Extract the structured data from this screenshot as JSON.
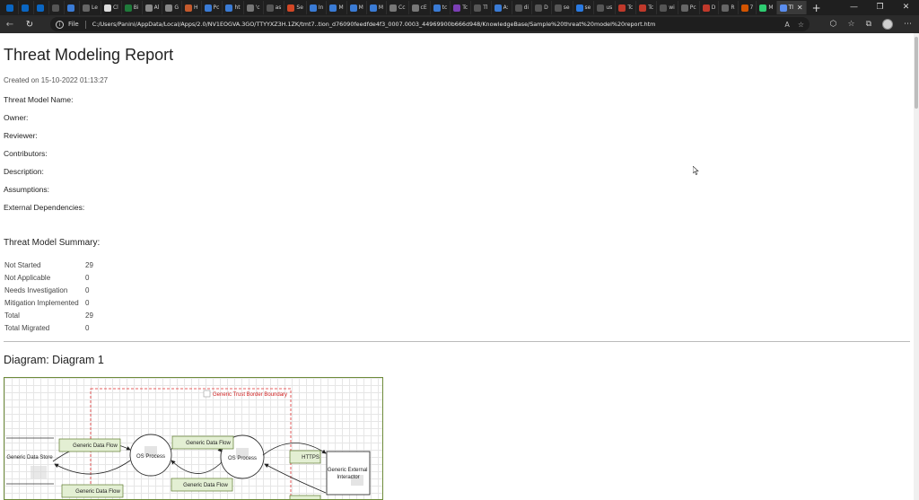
{
  "browser": {
    "tabs": [
      {
        "label": "",
        "color": "#0a66c2"
      },
      {
        "label": "",
        "color": "#0a66c2"
      },
      {
        "label": "",
        "color": "#0a66c2"
      },
      {
        "label": "",
        "color": "#555555"
      },
      {
        "label": "",
        "color": "#3a7bd5"
      },
      {
        "label": "Le",
        "color": "#666666"
      },
      {
        "label": "Cl",
        "color": "#dddddd"
      },
      {
        "label": "Bi",
        "color": "#1f7a3a"
      },
      {
        "label": "Al",
        "color": "#888888"
      },
      {
        "label": "G",
        "color": "#888888"
      },
      {
        "label": "H",
        "color": "#c45a2d"
      },
      {
        "label": "Pc",
        "color": "#3a7bd5"
      },
      {
        "label": "ht",
        "color": "#3a7bd5"
      },
      {
        "label": "'c",
        "color": "#777777"
      },
      {
        "label": "as",
        "color": "#555555"
      },
      {
        "label": "Se",
        "color": "#d24726"
      },
      {
        "label": "In",
        "color": "#3a7bd5"
      },
      {
        "label": "M",
        "color": "#3a7bd5"
      },
      {
        "label": "M",
        "color": "#3a7bd5"
      },
      {
        "label": "M",
        "color": "#3a7bd5"
      },
      {
        "label": "Cc",
        "color": "#777777"
      },
      {
        "label": "cE",
        "color": "#777777"
      },
      {
        "label": "tc",
        "color": "#3a7bd5"
      },
      {
        "label": "Tc",
        "color": "#7b3fb5"
      },
      {
        "label": "Tl",
        "color": "#555555"
      },
      {
        "label": "A:",
        "color": "#3a7bd5"
      },
      {
        "label": "di",
        "color": "#555555"
      },
      {
        "label": "D",
        "color": "#555555"
      },
      {
        "label": "se",
        "color": "#555555"
      },
      {
        "label": "se",
        "color": "#2a7ae2"
      },
      {
        "label": "us",
        "color": "#555555"
      },
      {
        "label": "Tc",
        "color": "#c0392b"
      },
      {
        "label": "Tc",
        "color": "#c0392b"
      },
      {
        "label": "wi",
        "color": "#555555"
      },
      {
        "label": "Pc",
        "color": "#666666"
      },
      {
        "label": "D",
        "color": "#c0392b"
      },
      {
        "label": "R",
        "color": "#666666"
      },
      {
        "label": "7",
        "color": "#d35400"
      },
      {
        "label": "M",
        "color": "#2ecc71"
      }
    ],
    "active_tab": {
      "label": "Tl",
      "close": "✕"
    },
    "new_tab": "+",
    "window_controls": [
      "—",
      "❐",
      "✕"
    ],
    "file_label": "File",
    "url": "C:/Users/Panini/AppData/Local/Apps/2.0/NV1EOGVA.3GO/TTYYXZ3H.1ZK/tmt7..tion_d76090feedfde4f3_0007.0003_44969900b666d948/KnowledgeBase/Sample%20threat%20model%20report.htm"
  },
  "report": {
    "title": "Threat Modeling Report",
    "created": "Created on 15-10-2022 01:13:27",
    "fields": [
      "Threat Model Name:",
      "Owner:",
      "Reviewer:",
      "Contributors:",
      "Description:",
      "Assumptions:",
      "External Dependencies:"
    ],
    "summary_title": "Threat Model Summary:",
    "summary": [
      {
        "label": "Not Started",
        "value": "29"
      },
      {
        "label": "Not Applicable",
        "value": "0"
      },
      {
        "label": "Needs Investigation",
        "value": "0"
      },
      {
        "label": "Mitigation Implemented",
        "value": "0"
      },
      {
        "label": "Total",
        "value": "29"
      },
      {
        "label": "Total Migrated",
        "value": "0"
      }
    ],
    "diagram_title": "Diagram: Diagram 1"
  },
  "diagram": {
    "boundary": "Generic Trust Border Boundary",
    "store": "Generic Data Store",
    "process1": "OS Process",
    "process2": "OS Process",
    "external": "Generic External Interactor",
    "flow1": "Generic Data Flow",
    "flow2": "Generic Data Flow",
    "flow3": "Generic Data Flow",
    "flow4": "Generic Data Flow",
    "flow5": "HTTPS",
    "colors": {
      "flow_fill": "#e3efd3",
      "flow_border": "#5c7a2e",
      "boundary": "#e03030",
      "frame": "#6e8c3b"
    }
  }
}
